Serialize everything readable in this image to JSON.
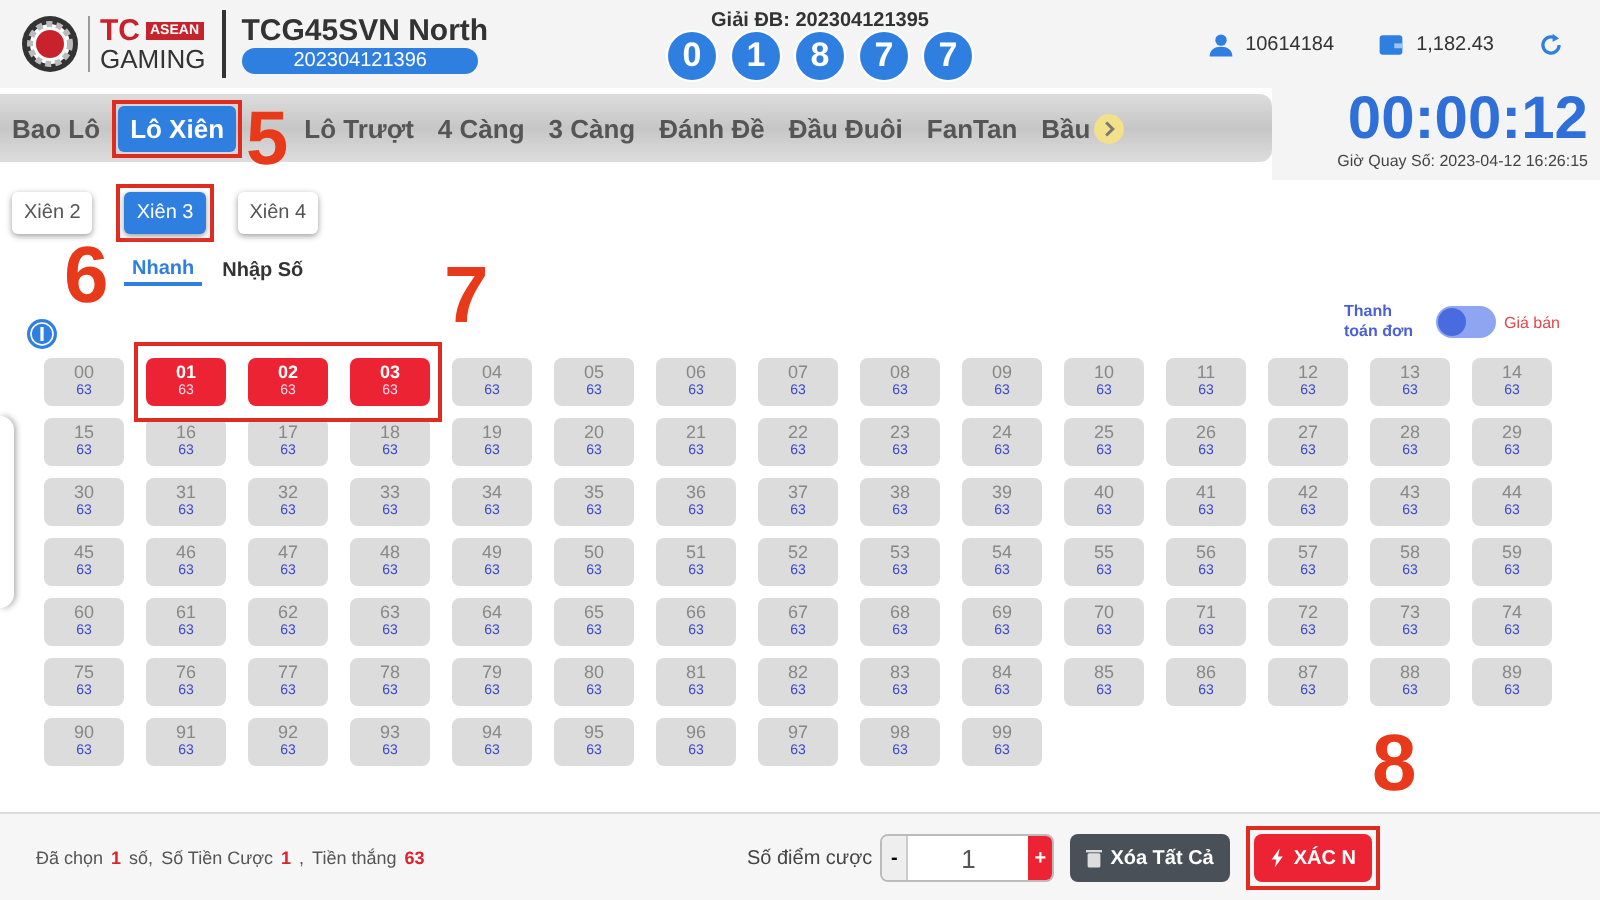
{
  "brand": {
    "name": "TC",
    "badge": "ASEAN",
    "sub": "GAMING"
  },
  "game": {
    "title": "TCG45SVN North",
    "period": "202304121396"
  },
  "result": {
    "label": "Giải ĐB: 202304121395",
    "balls": [
      "0",
      "1",
      "8",
      "7",
      "7"
    ]
  },
  "account": {
    "user_id": "10614184",
    "balance": "1,182.43"
  },
  "tabs": [
    {
      "label": "Bao Lô",
      "selected": false,
      "highlighted": false
    },
    {
      "label": "Lô Xiên",
      "selected": true,
      "highlighted": true
    },
    {
      "label": "Lô Trượt",
      "selected": false,
      "highlighted": false
    },
    {
      "label": "4 Càng",
      "selected": false,
      "highlighted": false
    },
    {
      "label": "3 Càng",
      "selected": false,
      "highlighted": false
    },
    {
      "label": "Đánh Đề",
      "selected": false,
      "highlighted": false
    },
    {
      "label": "Đầu Đuôi",
      "selected": false,
      "highlighted": false
    },
    {
      "label": "FanTan",
      "selected": false,
      "highlighted": false
    },
    {
      "label": "Bầu",
      "selected": false,
      "highlighted": false
    }
  ],
  "timer": {
    "countdown": "00:00:12",
    "draw_time": "Giờ Quay Số: 2023-04-12 16:26:15"
  },
  "subtabs": [
    {
      "label": "Xiên 2",
      "selected": false,
      "highlighted": false
    },
    {
      "label": "Xiên 3",
      "selected": true,
      "highlighted": true
    },
    {
      "label": "Xiên 4",
      "selected": false,
      "highlighted": false
    }
  ],
  "modes": [
    {
      "label": "Nhanh",
      "selected": true
    },
    {
      "label": "Nhập Số",
      "selected": false
    }
  ],
  "payment_toggle": {
    "left_label": "Thanh toán đơn",
    "right_label": "Giá bán",
    "on": false
  },
  "grid": {
    "highlighted": true,
    "cells": [
      {
        "number": "00",
        "odds": "63",
        "selected": false
      },
      {
        "number": "01",
        "odds": "63",
        "selected": true
      },
      {
        "number": "02",
        "odds": "63",
        "selected": true
      },
      {
        "number": "03",
        "odds": "63",
        "selected": true
      },
      {
        "number": "04",
        "odds": "63",
        "selected": false
      },
      {
        "number": "05",
        "odds": "63",
        "selected": false
      },
      {
        "number": "06",
        "odds": "63",
        "selected": false
      },
      {
        "number": "07",
        "odds": "63",
        "selected": false
      },
      {
        "number": "08",
        "odds": "63",
        "selected": false
      },
      {
        "number": "09",
        "odds": "63",
        "selected": false
      },
      {
        "number": "10",
        "odds": "63",
        "selected": false
      },
      {
        "number": "11",
        "odds": "63",
        "selected": false
      },
      {
        "number": "12",
        "odds": "63",
        "selected": false
      },
      {
        "number": "13",
        "odds": "63",
        "selected": false
      },
      {
        "number": "14",
        "odds": "63",
        "selected": false
      },
      {
        "number": "15",
        "odds": "63",
        "selected": false
      },
      {
        "number": "16",
        "odds": "63",
        "selected": false
      },
      {
        "number": "17",
        "odds": "63",
        "selected": false
      },
      {
        "number": "18",
        "odds": "63",
        "selected": false
      },
      {
        "number": "19",
        "odds": "63",
        "selected": false
      },
      {
        "number": "20",
        "odds": "63",
        "selected": false
      },
      {
        "number": "21",
        "odds": "63",
        "selected": false
      },
      {
        "number": "22",
        "odds": "63",
        "selected": false
      },
      {
        "number": "23",
        "odds": "63",
        "selected": false
      },
      {
        "number": "24",
        "odds": "63",
        "selected": false
      },
      {
        "number": "25",
        "odds": "63",
        "selected": false
      },
      {
        "number": "26",
        "odds": "63",
        "selected": false
      },
      {
        "number": "27",
        "odds": "63",
        "selected": false
      },
      {
        "number": "28",
        "odds": "63",
        "selected": false
      },
      {
        "number": "29",
        "odds": "63",
        "selected": false
      },
      {
        "number": "30",
        "odds": "63",
        "selected": false
      },
      {
        "number": "31",
        "odds": "63",
        "selected": false
      },
      {
        "number": "32",
        "odds": "63",
        "selected": false
      },
      {
        "number": "33",
        "odds": "63",
        "selected": false
      },
      {
        "number": "34",
        "odds": "63",
        "selected": false
      },
      {
        "number": "35",
        "odds": "63",
        "selected": false
      },
      {
        "number": "36",
        "odds": "63",
        "selected": false
      },
      {
        "number": "37",
        "odds": "63",
        "selected": false
      },
      {
        "number": "38",
        "odds": "63",
        "selected": false
      },
      {
        "number": "39",
        "odds": "63",
        "selected": false
      },
      {
        "number": "40",
        "odds": "63",
        "selected": false
      },
      {
        "number": "41",
        "odds": "63",
        "selected": false
      },
      {
        "number": "42",
        "odds": "63",
        "selected": false
      },
      {
        "number": "43",
        "odds": "63",
        "selected": false
      },
      {
        "number": "44",
        "odds": "63",
        "selected": false
      },
      {
        "number": "45",
        "odds": "63",
        "selected": false
      },
      {
        "number": "46",
        "odds": "63",
        "selected": false
      },
      {
        "number": "47",
        "odds": "63",
        "selected": false
      },
      {
        "number": "48",
        "odds": "63",
        "selected": false
      },
      {
        "number": "49",
        "odds": "63",
        "selected": false
      },
      {
        "number": "50",
        "odds": "63",
        "selected": false
      },
      {
        "number": "51",
        "odds": "63",
        "selected": false
      },
      {
        "number": "52",
        "odds": "63",
        "selected": false
      },
      {
        "number": "53",
        "odds": "63",
        "selected": false
      },
      {
        "number": "54",
        "odds": "63",
        "selected": false
      },
      {
        "number": "55",
        "odds": "63",
        "selected": false
      },
      {
        "number": "56",
        "odds": "63",
        "selected": false
      },
      {
        "number": "57",
        "odds": "63",
        "selected": false
      },
      {
        "number": "58",
        "odds": "63",
        "selected": false
      },
      {
        "number": "59",
        "odds": "63",
        "selected": false
      },
      {
        "number": "60",
        "odds": "63",
        "selected": false
      },
      {
        "number": "61",
        "odds": "63",
        "selected": false
      },
      {
        "number": "62",
        "odds": "63",
        "selected": false
      },
      {
        "number": "63",
        "odds": "63",
        "selected": false
      },
      {
        "number": "64",
        "odds": "63",
        "selected": false
      },
      {
        "number": "65",
        "odds": "63",
        "selected": false
      },
      {
        "number": "66",
        "odds": "63",
        "selected": false
      },
      {
        "number": "67",
        "odds": "63",
        "selected": false
      },
      {
        "number": "68",
        "odds": "63",
        "selected": false
      },
      {
        "number": "69",
        "odds": "63",
        "selected": false
      },
      {
        "number": "70",
        "odds": "63",
        "selected": false
      },
      {
        "number": "71",
        "odds": "63",
        "selected": false
      },
      {
        "number": "72",
        "odds": "63",
        "selected": false
      },
      {
        "number": "73",
        "odds": "63",
        "selected": false
      },
      {
        "number": "74",
        "odds": "63",
        "selected": false
      },
      {
        "number": "75",
        "odds": "63",
        "selected": false
      },
      {
        "number": "76",
        "odds": "63",
        "selected": false
      },
      {
        "number": "77",
        "odds": "63",
        "selected": false
      },
      {
        "number": "78",
        "odds": "63",
        "selected": false
      },
      {
        "number": "79",
        "odds": "63",
        "selected": false
      },
      {
        "number": "80",
        "odds": "63",
        "selected": false
      },
      {
        "number": "81",
        "odds": "63",
        "selected": false
      },
      {
        "number": "82",
        "odds": "63",
        "selected": false
      },
      {
        "number": "83",
        "odds": "63",
        "selected": false
      },
      {
        "number": "84",
        "odds": "63",
        "selected": false
      },
      {
        "number": "85",
        "odds": "63",
        "selected": false
      },
      {
        "number": "86",
        "odds": "63",
        "selected": false
      },
      {
        "number": "87",
        "odds": "63",
        "selected": false
      },
      {
        "number": "88",
        "odds": "63",
        "selected": false
      },
      {
        "number": "89",
        "odds": "63",
        "selected": false
      },
      {
        "number": "90",
        "odds": "63",
        "selected": false
      },
      {
        "number": "91",
        "odds": "63",
        "selected": false
      },
      {
        "number": "92",
        "odds": "63",
        "selected": false
      },
      {
        "number": "93",
        "odds": "63",
        "selected": false
      },
      {
        "number": "94",
        "odds": "63",
        "selected": false
      },
      {
        "number": "95",
        "odds": "63",
        "selected": false
      },
      {
        "number": "96",
        "odds": "63",
        "selected": false
      },
      {
        "number": "97",
        "odds": "63",
        "selected": false
      },
      {
        "number": "98",
        "odds": "63",
        "selected": false
      },
      {
        "number": "99",
        "odds": "63",
        "selected": false
      }
    ]
  },
  "summary": [
    {
      "text": "Đã chọn",
      "kind": "label"
    },
    {
      "text": "1",
      "kind": "value"
    },
    {
      "text": "số,",
      "kind": "label"
    },
    {
      "text": "Số Tiền Cược",
      "kind": "label"
    },
    {
      "text": "1",
      "kind": "value"
    },
    {
      "text": ",",
      "kind": "label"
    },
    {
      "text": "Tiền thắng",
      "kind": "label"
    },
    {
      "text": "63",
      "kind": "value"
    }
  ],
  "stake": {
    "label": "Số điểm cược",
    "minus": "-",
    "value": "1",
    "plus": "+"
  },
  "buttons": [
    {
      "label": "Xóa Tất Cả",
      "kind": "clear",
      "highlighted": false
    },
    {
      "label": "XÁC N",
      "kind": "confirm",
      "highlighted": true
    }
  ],
  "annotations": [
    "5",
    "6",
    "7",
    "8"
  ]
}
